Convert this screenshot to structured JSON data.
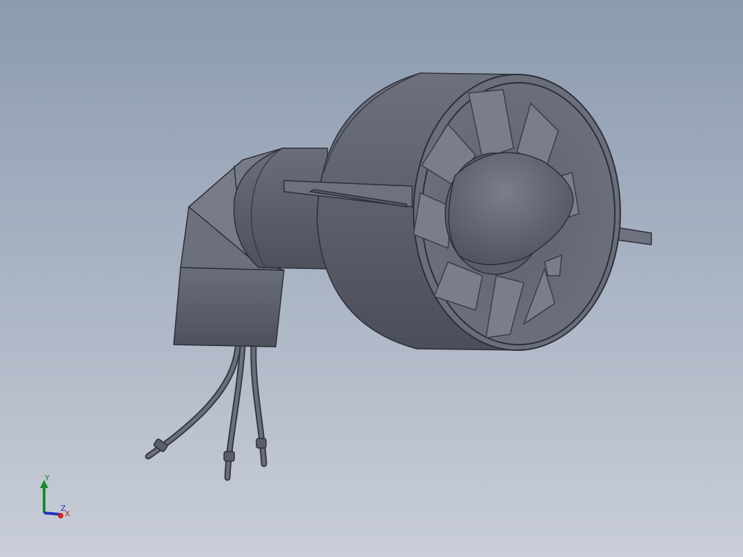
{
  "viewport": {
    "background_top": "#8c9bb0",
    "background_bottom": "#c9ced8",
    "model_color": "#5a5e6b"
  },
  "triad": {
    "x_label": "X",
    "y_label": "Y",
    "z_label": "Z",
    "x_color": "#d02020",
    "y_color": "#1a8a2a",
    "z_color": "#2030c0"
  }
}
